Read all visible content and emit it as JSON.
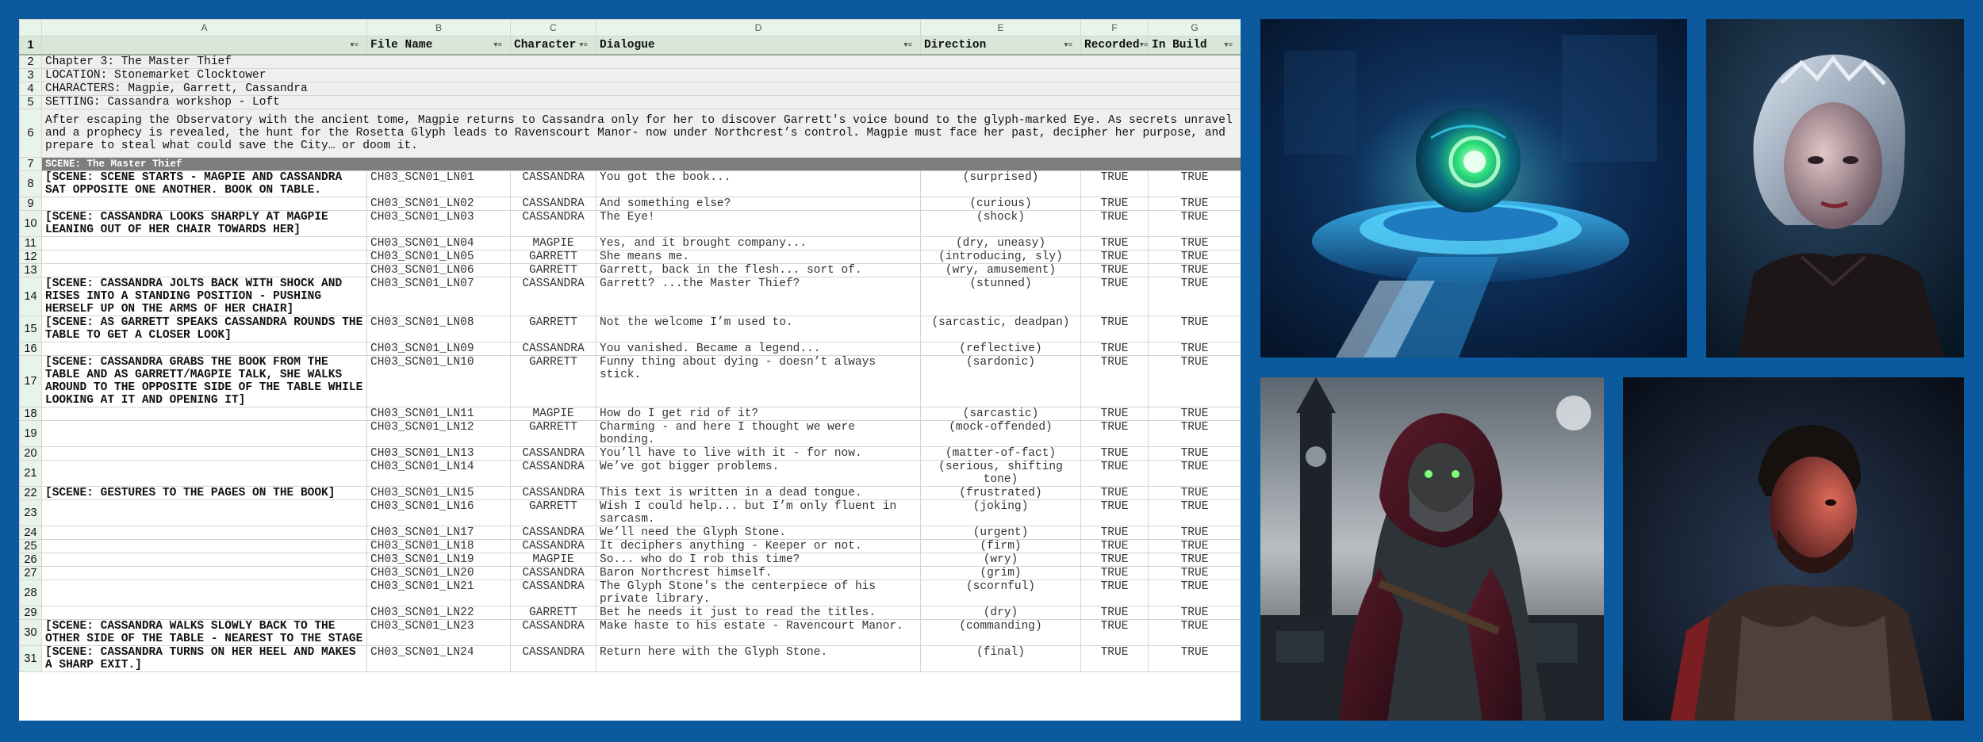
{
  "sheet": {
    "column_letters": [
      "A",
      "B",
      "C",
      "D",
      "E",
      "F",
      "G"
    ],
    "headers": [
      "",
      "File Name",
      "Character",
      "Dialogue",
      "Direction",
      "Recorded",
      "In Build"
    ],
    "intro": [
      "Chapter 3: The Master Thief",
      "LOCATION: Stonemarket Clocktower",
      "CHARACTERS: Magpie, Garrett, Cassandra",
      "SETTING: Cassandra workshop - Loft",
      "After escaping the Observatory with the ancient tome, Magpie returns to Cassandra only for her to discover Garrett's voice bound to the glyph-marked Eye. As secrets unravel and a prophecy is revealed, the hunt for the Rosetta Glyph leads to Ravenscourt Manor- now under Northcrest’s control. Magpie must face her past, decipher her purpose, and prepare to steal what could save the City… or doom it."
    ],
    "scene_banner": "SCENE: The Master Thief",
    "rows": [
      {
        "n": "8",
        "dir": "[SCENE: SCENE STARTS - MAGPIE AND CASSANDRA SAT OPPOSITE ONE ANOTHER. BOOK ON TABLE.",
        "file": "CH03_SCN01_LN01",
        "ch": "CASSANDRA",
        "line": "You got the book...",
        "direction": "(surprised)",
        "rec": "TRUE",
        "build": "TRUE"
      },
      {
        "n": "9",
        "dir": "",
        "file": "CH03_SCN01_LN02",
        "ch": "CASSANDRA",
        "line": "And something else?",
        "direction": "(curious)",
        "rec": "TRUE",
        "build": "TRUE"
      },
      {
        "n": "10",
        "dir": "[SCENE: CASSANDRA LOOKS SHARPLY AT MAGPIE LEANING OUT OF HER CHAIR TOWARDS HER]",
        "file": "CH03_SCN01_LN03",
        "ch": "CASSANDRA",
        "line": "The Eye!",
        "direction": "(shock)",
        "rec": "TRUE",
        "build": "TRUE"
      },
      {
        "n": "11",
        "dir": "",
        "file": "CH03_SCN01_LN04",
        "ch": "MAGPIE",
        "line": "Yes, and it brought company...",
        "direction": "(dry, uneasy)",
        "rec": "TRUE",
        "build": "TRUE"
      },
      {
        "n": "12",
        "dir": "",
        "file": "CH03_SCN01_LN05",
        "ch": "GARRETT",
        "line": "She means me.",
        "direction": "(introducing, sly)",
        "rec": "TRUE",
        "build": "TRUE"
      },
      {
        "n": "13",
        "dir": "",
        "file": "CH03_SCN01_LN06",
        "ch": "GARRETT",
        "line": "Garrett, back in the flesh... sort of.",
        "direction": "(wry, amusement)",
        "rec": "TRUE",
        "build": "TRUE"
      },
      {
        "n": "14",
        "dir": "[SCENE: CASSANDRA JOLTS BACK WITH SHOCK AND RISES INTO A STANDING POSITION - PUSHING HERSELF UP ON THE ARMS OF HER CHAIR]",
        "file": "CH03_SCN01_LN07",
        "ch": "CASSANDRA",
        "line": "Garrett? ...the Master Thief?",
        "direction": "(stunned)",
        "rec": "TRUE",
        "build": "TRUE"
      },
      {
        "n": "15",
        "dir": "[SCENE: AS GARRETT SPEAKS CASSANDRA ROUNDS THE TABLE TO GET A CLOSER LOOK]",
        "file": "CH03_SCN01_LN08",
        "ch": "GARRETT",
        "line": "Not the welcome I’m used to.",
        "direction": "(sarcastic, deadpan)",
        "rec": "TRUE",
        "build": "TRUE"
      },
      {
        "n": "16",
        "dir": "",
        "file": "CH03_SCN01_LN09",
        "ch": "CASSANDRA",
        "line": "You vanished. Became a legend...",
        "direction": "(reflective)",
        "rec": "TRUE",
        "build": "TRUE"
      },
      {
        "n": "17",
        "dir": "[SCENE: CASSANDRA GRABS THE BOOK FROM THE TABLE AND AS GARRETT/MAGPIE TALK, SHE WALKS AROUND TO THE OPPOSITE SIDE OF THE TABLE WHILE LOOKING AT IT AND OPENING IT]",
        "file": "CH03_SCN01_LN10",
        "ch": "GARRETT",
        "line": "Funny thing about dying - doesn’t always stick.",
        "direction": "(sardonic)",
        "rec": "TRUE",
        "build": "TRUE"
      },
      {
        "n": "18",
        "dir": "",
        "file": "CH03_SCN01_LN11",
        "ch": "MAGPIE",
        "line": "How do I get rid of it?",
        "direction": "(sarcastic)",
        "rec": "TRUE",
        "build": "TRUE"
      },
      {
        "n": "19",
        "dir": "",
        "file": "CH03_SCN01_LN12",
        "ch": "GARRETT",
        "line": "Charming - and here I thought we were bonding.",
        "direction": "(mock-offended)",
        "rec": "TRUE",
        "build": "TRUE"
      },
      {
        "n": "20",
        "dir": "",
        "file": "CH03_SCN01_LN13",
        "ch": "CASSANDRA",
        "line": "You’ll have to live with it - for now.",
        "direction": "(matter-of-fact)",
        "rec": "TRUE",
        "build": "TRUE"
      },
      {
        "n": "21",
        "dir": "",
        "file": "CH03_SCN01_LN14",
        "ch": "CASSANDRA",
        "line": "We’ve got bigger problems.",
        "direction": "(serious, shifting tone)",
        "rec": "TRUE",
        "build": "TRUE"
      },
      {
        "n": "22",
        "dir": "[SCENE: GESTURES TO THE PAGES ON THE BOOK]",
        "file": "CH03_SCN01_LN15",
        "ch": "CASSANDRA",
        "line": "This text is written in a dead tongue.",
        "direction": "(frustrated)",
        "rec": "TRUE",
        "build": "TRUE"
      },
      {
        "n": "23",
        "dir": "",
        "file": "CH03_SCN01_LN16",
        "ch": "GARRETT",
        "line": "Wish I could help... but I’m only fluent in sarcasm.",
        "direction": "(joking)",
        "rec": "TRUE",
        "build": "TRUE"
      },
      {
        "n": "24",
        "dir": "",
        "file": "CH03_SCN01_LN17",
        "ch": "CASSANDRA",
        "line": "We’ll need the Glyph Stone.",
        "direction": "(urgent)",
        "rec": "TRUE",
        "build": "TRUE"
      },
      {
        "n": "25",
        "dir": "",
        "file": "CH03_SCN01_LN18",
        "ch": "CASSANDRA",
        "line": "It deciphers anything - Keeper or not.",
        "direction": "(firm)",
        "rec": "TRUE",
        "build": "TRUE"
      },
      {
        "n": "26",
        "dir": "",
        "file": "CH03_SCN01_LN19",
        "ch": "MAGPIE",
        "line": "So... who do I rob this time?",
        "direction": "(wry)",
        "rec": "TRUE",
        "build": "TRUE"
      },
      {
        "n": "27",
        "dir": "",
        "file": "CH03_SCN01_LN20",
        "ch": "CASSANDRA",
        "line": "Baron Northcrest himself.",
        "direction": "(grim)",
        "rec": "TRUE",
        "build": "TRUE"
      },
      {
        "n": "28",
        "dir": "",
        "file": "CH03_SCN01_LN21",
        "ch": "CASSANDRA",
        "line": "The Glyph Stone's the centerpiece of his private library.",
        "direction": "(scornful)",
        "rec": "TRUE",
        "build": "TRUE"
      },
      {
        "n": "29",
        "dir": "",
        "file": "CH03_SCN01_LN22",
        "ch": "GARRETT",
        "line": "Bet he needs it just to read the titles.",
        "direction": "(dry)",
        "rec": "TRUE",
        "build": "TRUE"
      },
      {
        "n": "30",
        "dir": "[SCENE: CASSANDRA WALKS SLOWLY BACK TO THE OTHER SIDE OF THE TABLE - NEAREST TO THE STAGE",
        "file": "CH03_SCN01_LN23",
        "ch": "CASSANDRA",
        "line": "Make haste to his estate - Ravencourt Manor.",
        "direction": "(commanding)",
        "rec": "TRUE",
        "build": "TRUE"
      },
      {
        "n": "31",
        "dir": "[SCENE: CASSANDRA TURNS ON HER HEEL AND MAKES A SHARP EXIT.]",
        "file": "CH03_SCN01_LN24",
        "ch": "CASSANDRA",
        "line": "Return here with the Glyph Stone.",
        "direction": "(final)",
        "rec": "TRUE",
        "build": "TRUE"
      }
    ]
  },
  "images": {
    "top_left": "glowing-eye-orb-pedestal",
    "top_right": "silver-haired-woman-portrait",
    "bottom_left": "hooded-masked-thief-clocktower",
    "bottom_right": "bearded-man-red-light"
  }
}
